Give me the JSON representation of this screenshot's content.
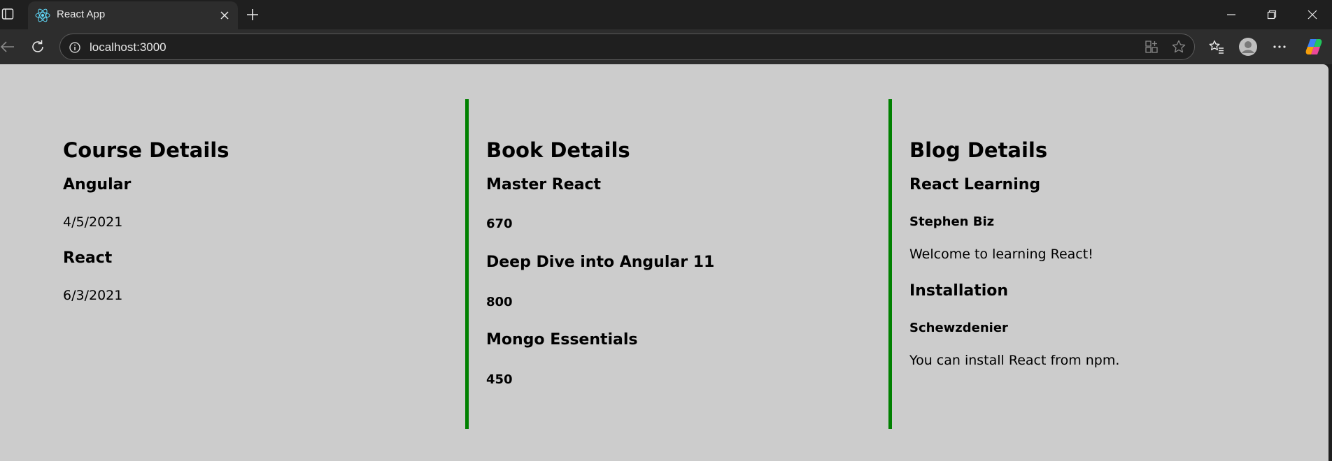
{
  "browser": {
    "tab_title": "React App",
    "url": "localhost:3000"
  },
  "colors": {
    "divider": "#008000",
    "page_bg": "#cccccc",
    "chrome_bg": "#1f1f1f"
  },
  "course": {
    "title": "Course Details",
    "items": [
      {
        "name": "Angular",
        "date": "4/5/2021"
      },
      {
        "name": "React",
        "date": "6/3/2021"
      }
    ]
  },
  "book": {
    "title": "Book Details",
    "items": [
      {
        "name": "Master React",
        "price": "670"
      },
      {
        "name": "Deep Dive into Angular 11",
        "price": "800"
      },
      {
        "name": "Mongo Essentials",
        "price": "450"
      }
    ]
  },
  "blog": {
    "title": "Blog Details",
    "items": [
      {
        "title": "React Learning",
        "author": "Stephen Biz",
        "content": "Welcome to learning React!"
      },
      {
        "title": "Installation",
        "author": "Schewzdenier",
        "content": "You can install React from npm."
      }
    ]
  }
}
